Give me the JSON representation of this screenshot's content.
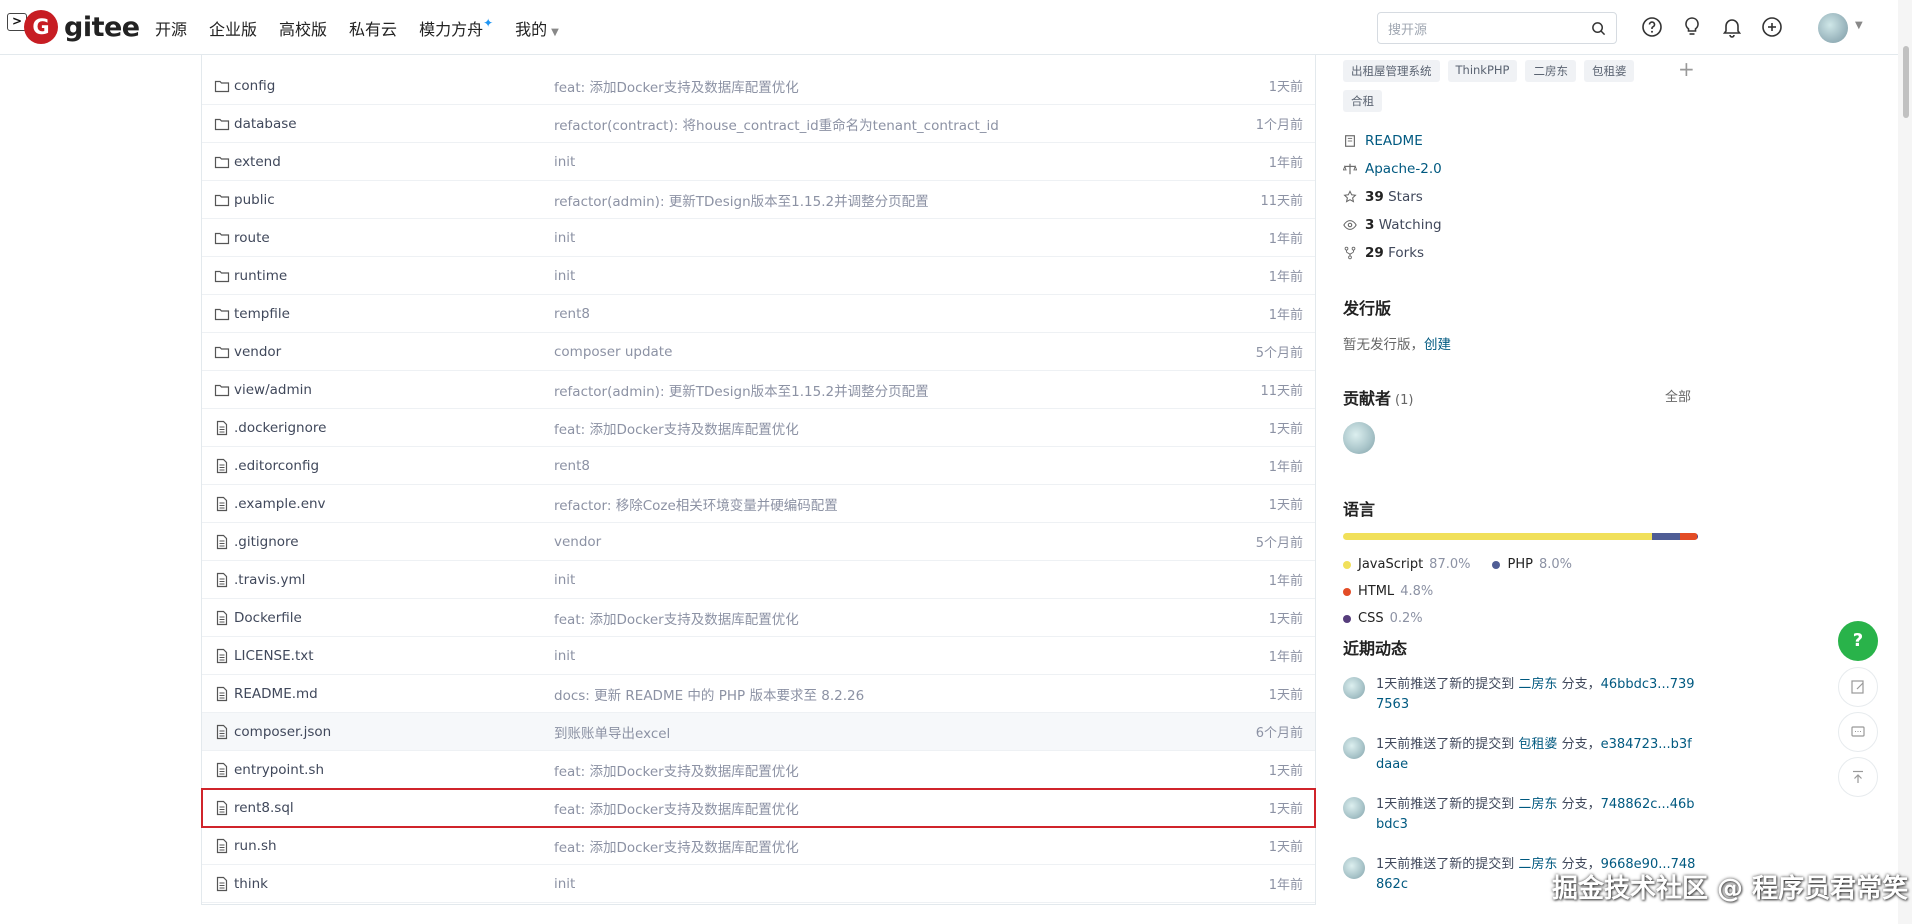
{
  "header": {
    "terminal_glyph": ">",
    "logo_letter": "G",
    "logo_text": "gitee",
    "nav": [
      {
        "label": "开源"
      },
      {
        "label": "企业版"
      },
      {
        "label": "高校版"
      },
      {
        "label": "私有云"
      },
      {
        "label": "模力方舟",
        "badge": "✦"
      },
      {
        "label": "我的",
        "dropdown": true
      }
    ],
    "search_placeholder": "搜开源"
  },
  "files": [
    {
      "type": "folder",
      "name": "config",
      "message": "feat: 添加Docker支持及数据库配置优化",
      "time": "1天前"
    },
    {
      "type": "folder",
      "name": "database",
      "message": "refactor(contract): 将house_contract_id重命名为tenant_contract_id",
      "time": "1个月前"
    },
    {
      "type": "folder",
      "name": "extend",
      "message": "init",
      "time": "1年前"
    },
    {
      "type": "folder",
      "name": "public",
      "message": "refactor(admin): 更新TDesign版本至1.15.2并调整分页配置",
      "time": "11天前"
    },
    {
      "type": "folder",
      "name": "route",
      "message": "init",
      "time": "1年前"
    },
    {
      "type": "folder",
      "name": "runtime",
      "message": "init",
      "time": "1年前"
    },
    {
      "type": "folder",
      "name": "tempfile",
      "message": "rent8",
      "time": "1年前"
    },
    {
      "type": "folder",
      "name": "vendor",
      "message": "composer update",
      "time": "5个月前"
    },
    {
      "type": "folder",
      "name": "view/admin",
      "message": "refactor(admin): 更新TDesign版本至1.15.2并调整分页配置",
      "time": "11天前"
    },
    {
      "type": "file",
      "name": ".dockerignore",
      "message": "feat: 添加Docker支持及数据库配置优化",
      "time": "1天前"
    },
    {
      "type": "file",
      "name": ".editorconfig",
      "message": "rent8",
      "time": "1年前"
    },
    {
      "type": "file",
      "name": ".example.env",
      "message": "refactor: 移除Coze相关环境变量并硬编码配置",
      "time": "1天前"
    },
    {
      "type": "file",
      "name": ".gitignore",
      "message": "vendor",
      "time": "5个月前"
    },
    {
      "type": "file",
      "name": ".travis.yml",
      "message": "init",
      "time": "1年前"
    },
    {
      "type": "file",
      "name": "Dockerfile",
      "message": "feat: 添加Docker支持及数据库配置优化",
      "time": "1天前"
    },
    {
      "type": "file",
      "name": "LICENSE.txt",
      "message": "init",
      "time": "1年前"
    },
    {
      "type": "file",
      "name": "README.md",
      "message": "docs: 更新 README 中的 PHP 版本要求至 8.2.26",
      "time": "1天前"
    },
    {
      "type": "file",
      "name": "composer.json",
      "message": "到账账单导出excel",
      "time": "6个月前",
      "hovered": true
    },
    {
      "type": "file",
      "name": "entrypoint.sh",
      "message": "feat: 添加Docker支持及数据库配置优化",
      "time": "1天前"
    },
    {
      "type": "file",
      "name": "rent8.sql",
      "message": "feat: 添加Docker支持及数据库配置优化",
      "time": "1天前",
      "highlighted": true
    },
    {
      "type": "file",
      "name": "run.sh",
      "message": "feat: 添加Docker支持及数据库配置优化",
      "time": "1天前"
    },
    {
      "type": "file",
      "name": "think",
      "message": "init",
      "time": "1年前"
    }
  ],
  "sidebar": {
    "tags": [
      "出租屋管理系统",
      "ThinkPHP",
      "二房东",
      "包租婆",
      "合租"
    ],
    "readme": "README",
    "license": "Apache-2.0",
    "stars_count": "39",
    "stars_label": "Stars",
    "watching_count": "3",
    "watching_label": "Watching",
    "forks_count": "29",
    "forks_label": "Forks",
    "releases_title": "发行版",
    "releases_text": "暂无发行版，",
    "releases_create": "创建",
    "contributors_title": "贡献者",
    "contributors_count": "(1)",
    "contributors_all": "全部",
    "languages_title": "语言",
    "languages": [
      {
        "name": "JavaScript",
        "percent": "87.0%",
        "value": 87.0,
        "color": "#f1e05a"
      },
      {
        "name": "PHP",
        "percent": "8.0%",
        "value": 8.0,
        "color": "#4f5d95"
      },
      {
        "name": "HTML",
        "percent": "4.8%",
        "value": 4.8,
        "color": "#e34c26"
      },
      {
        "name": "CSS",
        "percent": "0.2%",
        "value": 0.2,
        "color": "#563d7c"
      }
    ],
    "activity_title": "近期动态",
    "activities": [
      {
        "text": "1天前推送了新的提交到",
        "branch": "二房东",
        "suffix": "分支，",
        "commit": "46bbdc3...7397563"
      },
      {
        "text": "1天前推送了新的提交到",
        "branch": "包租婆",
        "suffix": "分支，",
        "commit": "e384723...b3fdaae"
      },
      {
        "text": "1天前推送了新的提交到",
        "branch": "二房东",
        "suffix": "分支，",
        "commit": "748862c...46bbdc3"
      },
      {
        "text": "1天前推送了新的提交到",
        "branch": "二房东",
        "suffix": "分支，",
        "commit": "9668e90...748862c"
      }
    ]
  },
  "fab": {
    "help": "?"
  },
  "watermark": "掘金技术社区 @ 程序员君常笑"
}
